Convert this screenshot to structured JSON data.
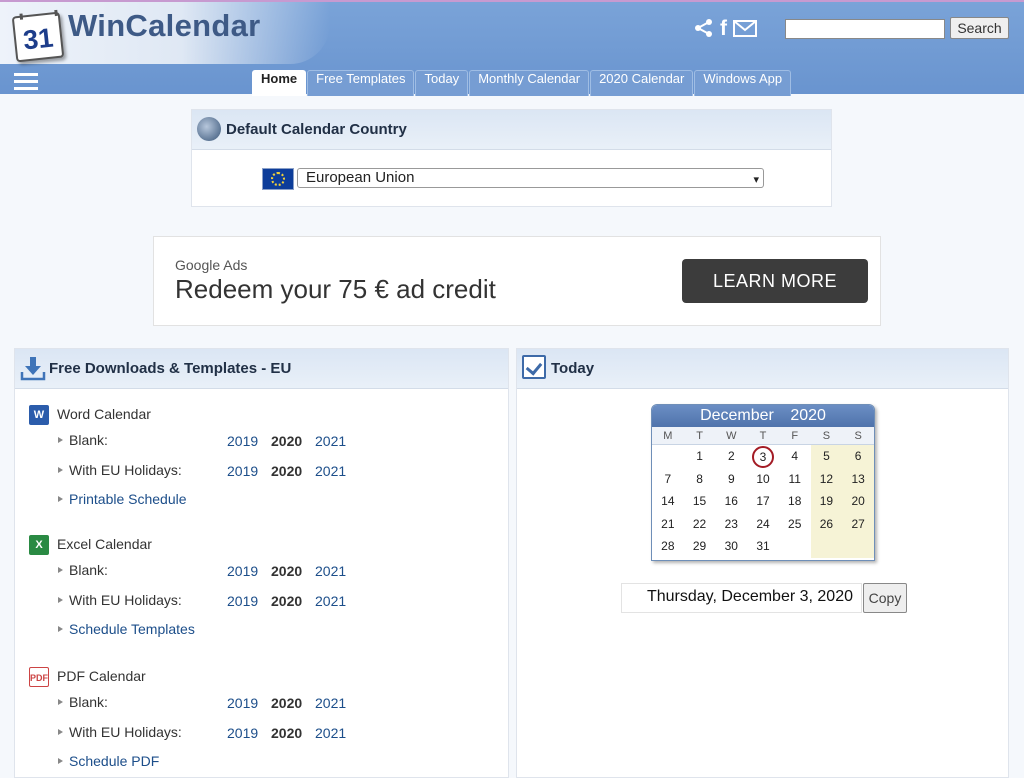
{
  "header": {
    "logo_number": "31",
    "brand": "WinCalendar",
    "search": {
      "value": "",
      "placeholder": "",
      "button": "Search"
    },
    "social": [
      "share-icon",
      "facebook-icon",
      "mail-icon"
    ]
  },
  "nav": {
    "tabs": [
      "Home",
      "Free Templates",
      "Today",
      "Monthly Calendar",
      "2020 Calendar",
      "Windows App"
    ],
    "active": "Home"
  },
  "country": {
    "title": "Default Calendar Country",
    "selected": "European Union"
  },
  "ad": {
    "brand": "Google Ads",
    "headline": "Redeem your 75 € ad credit",
    "button": "LEARN MORE"
  },
  "downloads": {
    "title": "Free Downloads & Templates - EU",
    "sections": [
      {
        "title": "Word Calendar",
        "icon": "word-icon",
        "rows": [
          {
            "label": "Blank:",
            "years": [
              "2019",
              "2020",
              "2021"
            ]
          },
          {
            "label": "With EU Holidays:",
            "years": [
              "2019",
              "2020",
              "2021"
            ]
          }
        ],
        "link": "Printable Schedule"
      },
      {
        "title": "Excel Calendar",
        "icon": "excel-icon",
        "rows": [
          {
            "label": "Blank:",
            "years": [
              "2019",
              "2020",
              "2021"
            ]
          },
          {
            "label": "With EU Holidays:",
            "years": [
              "2019",
              "2020",
              "2021"
            ]
          }
        ],
        "link": "Schedule Templates"
      },
      {
        "title": "PDF Calendar",
        "icon": "pdf-icon",
        "rows": [
          {
            "label": "Blank:",
            "years": [
              "2019",
              "2020",
              "2021"
            ]
          },
          {
            "label": "With EU Holidays:",
            "years": [
              "2019",
              "2020",
              "2021"
            ]
          }
        ],
        "link": "Schedule PDF"
      }
    ]
  },
  "today": {
    "title": "Today",
    "calendar": {
      "month": "December",
      "year": "2020",
      "weekdays": [
        "M",
        "T",
        "W",
        "T",
        "F",
        "S",
        "S"
      ],
      "weeks": [
        [
          "",
          "1",
          "2",
          "3",
          "4",
          "5",
          "6"
        ],
        [
          "7",
          "8",
          "9",
          "10",
          "11",
          "12",
          "13"
        ],
        [
          "14",
          "15",
          "16",
          "17",
          "18",
          "19",
          "20"
        ],
        [
          "21",
          "22",
          "23",
          "24",
          "25",
          "26",
          "27"
        ],
        [
          "28",
          "29",
          "30",
          "31",
          "",
          "",
          ""
        ]
      ],
      "today": "3"
    },
    "date_text": "Thursday, December 3, 2020",
    "copy_button": "Copy"
  }
}
